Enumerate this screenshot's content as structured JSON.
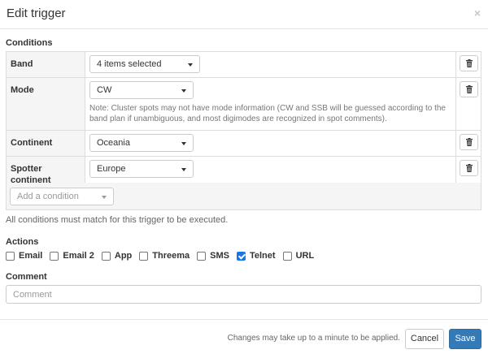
{
  "modal": {
    "title": "Edit trigger",
    "close": "×"
  },
  "conditions": {
    "heading": "Conditions",
    "rows": [
      {
        "label": "Band",
        "value": "4 items selected",
        "note": ""
      },
      {
        "label": "Mode",
        "value": "CW",
        "note": "Note: Cluster spots may not have mode information (CW and SSB will be guessed according to the band plan if unambiguous, and most digimodes are recognized in spot comments)."
      },
      {
        "label": "Continent",
        "value": "Oceania",
        "note": ""
      },
      {
        "label": "Spotter continent",
        "value": "Europe",
        "note": ""
      }
    ],
    "add_placeholder": "Add a condition",
    "help": "All conditions must match for this trigger to be executed."
  },
  "actions": {
    "heading": "Actions",
    "items": [
      {
        "label": "Email",
        "checked": false
      },
      {
        "label": "Email 2",
        "checked": false
      },
      {
        "label": "App",
        "checked": false
      },
      {
        "label": "Threema",
        "checked": false
      },
      {
        "label": "SMS",
        "checked": false
      },
      {
        "label": "Telnet",
        "checked": true
      },
      {
        "label": "URL",
        "checked": false
      }
    ]
  },
  "comment": {
    "heading": "Comment",
    "placeholder": "Comment",
    "value": ""
  },
  "footer": {
    "note": "Changes may take up to a minute to be applied.",
    "cancel": "Cancel",
    "save": "Save"
  },
  "colors": {
    "primary": "#337ab7",
    "checked": "#1a73e8"
  },
  "icons": {
    "delete": "trash-icon",
    "dropdown": "caret-down-icon",
    "close": "close-icon"
  }
}
